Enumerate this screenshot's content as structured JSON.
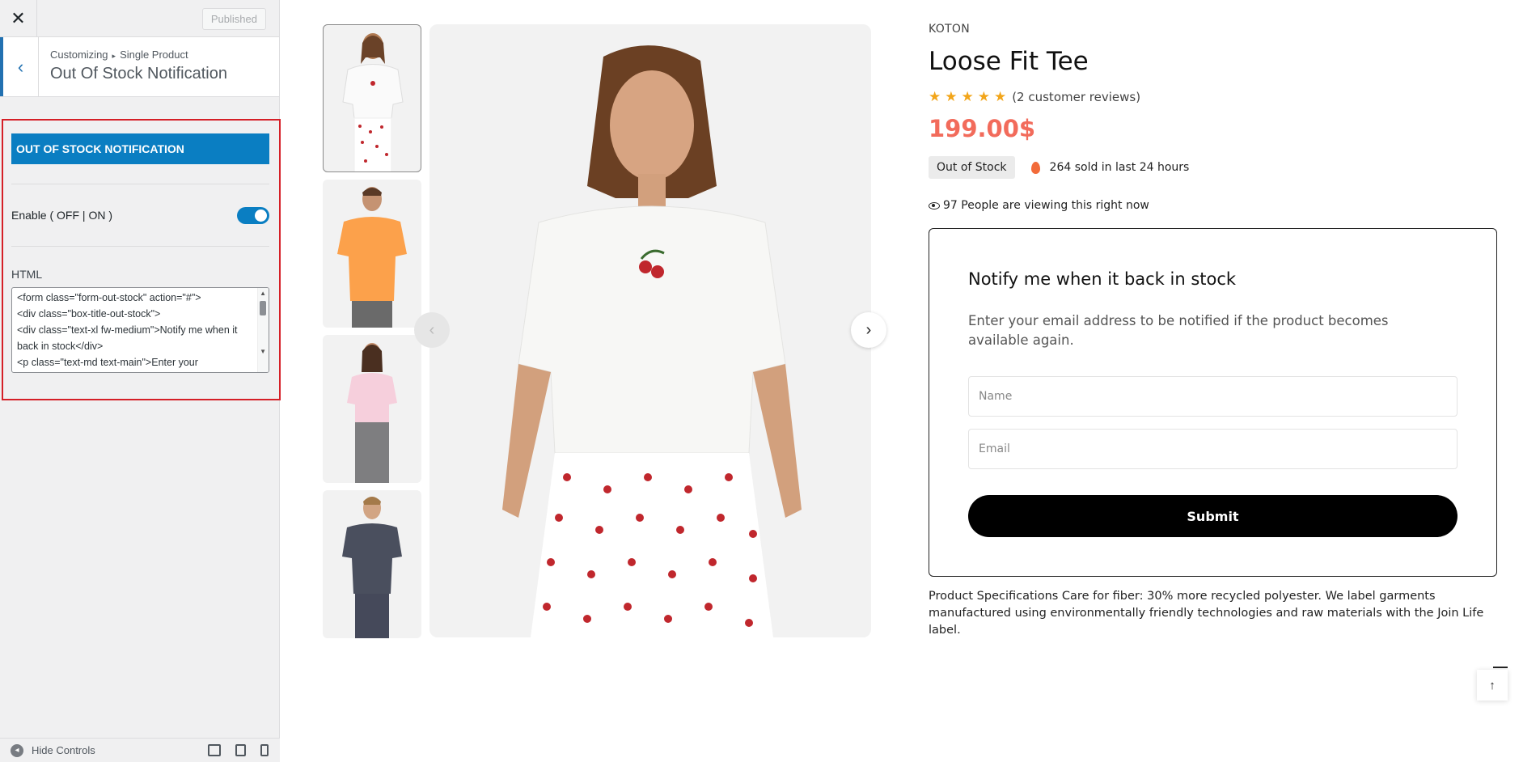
{
  "customizer": {
    "close_glyph": "✕",
    "publish_label": "Published",
    "back_glyph": "‹",
    "breadcrumb_root": "Customizing",
    "breadcrumb_sep": "▸",
    "breadcrumb_leaf": "Single Product",
    "section_title": "Out Of Stock Notification",
    "panel": {
      "heading": "OUT OF STOCK NOTIFICATION",
      "toggle_label": "Enable ( OFF | ON )",
      "toggle_on": true,
      "html_label": "HTML",
      "html_value": "<form class=\"form-out-stock\" action=\"#\">\n<div class=\"box-title-out-stock\">\n<div class=\"text-xl fw-medium\">Notify me when it back in stock</div>\n<p class=\"text-md text-main\">Enter your"
    },
    "footer": {
      "hide_controls": "Hide Controls"
    },
    "accent_color": "#0a7ec2",
    "highlight_color": "#d51f27"
  },
  "product": {
    "brand": "KOTON",
    "title": "Loose Fit Tee",
    "stars": "★★★★★",
    "rating": 4.5,
    "reviews": "(2 customer reviews)",
    "price": "199.00$",
    "stock_badge": "Out of Stock",
    "sold_text": "264 sold in last 24 hours",
    "viewing_text": "97 People are viewing this right now",
    "notify": {
      "title": "Notify me when it back in stock",
      "description": "Enter your email address to be notified if the product becomes available again.",
      "name_placeholder": "Name",
      "email_placeholder": "Email",
      "submit_label": "Submit"
    },
    "specs": "Product Specifications Care for fiber: 30% more recycled polyester. We label garments manufactured using environmentally friendly technologies and raw materials with the Join Life label.",
    "price_color": "#f26b5b",
    "star_color": "#f2a51a"
  },
  "gallery": {
    "prev_glyph": "‹",
    "next_glyph": "›",
    "thumbnails": [
      "white-tee-cherry-skirt",
      "orange-tee",
      "pink-tee",
      "navy-tee"
    ]
  },
  "back_to_top_glyph": "↑"
}
